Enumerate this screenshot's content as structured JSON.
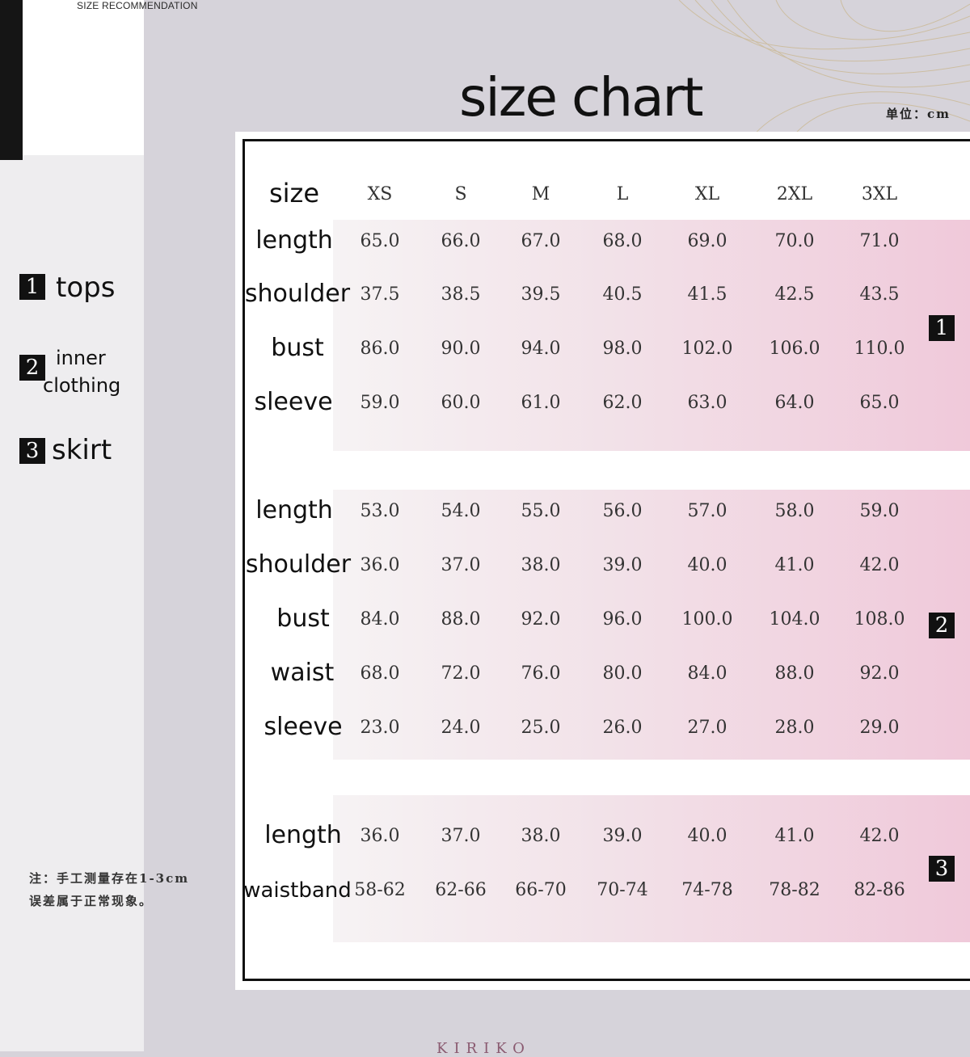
{
  "header_caption": "SIZE RECOMMENDATION",
  "title": "size chart",
  "unit": "单位：cm",
  "legend": [
    {
      "num": "1",
      "label": "tops"
    },
    {
      "num": "2",
      "label_line1": "inner",
      "label_line2": "clothing"
    },
    {
      "num": "3",
      "label": "skirt"
    }
  ],
  "sizes_label": "size",
  "sizes": [
    "XS",
    "S",
    "M",
    "L",
    "XL",
    "2XL",
    "3XL"
  ],
  "groups": [
    {
      "num": "1",
      "rows": [
        {
          "label": "length",
          "values": [
            "65.0",
            "66.0",
            "67.0",
            "68.0",
            "69.0",
            "70.0",
            "71.0"
          ]
        },
        {
          "label": "shoulder",
          "values": [
            "37.5",
            "38.5",
            "39.5",
            "40.5",
            "41.5",
            "42.5",
            "43.5"
          ]
        },
        {
          "label": "bust",
          "values": [
            "86.0",
            "90.0",
            "94.0",
            "98.0",
            "102.0",
            "106.0",
            "110.0"
          ]
        },
        {
          "label": "sleeve",
          "values": [
            "59.0",
            "60.0",
            "61.0",
            "62.0",
            "63.0",
            "64.0",
            "65.0"
          ]
        }
      ]
    },
    {
      "num": "2",
      "rows": [
        {
          "label": "length",
          "values": [
            "53.0",
            "54.0",
            "55.0",
            "56.0",
            "57.0",
            "58.0",
            "59.0"
          ]
        },
        {
          "label": "shoulder",
          "values": [
            "36.0",
            "37.0",
            "38.0",
            "39.0",
            "40.0",
            "41.0",
            "42.0"
          ]
        },
        {
          "label": "bust",
          "values": [
            "84.0",
            "88.0",
            "92.0",
            "96.0",
            "100.0",
            "104.0",
            "108.0"
          ]
        },
        {
          "label": "waist",
          "values": [
            "68.0",
            "72.0",
            "76.0",
            "80.0",
            "84.0",
            "88.0",
            "92.0"
          ]
        },
        {
          "label": "sleeve",
          "values": [
            "23.0",
            "24.0",
            "25.0",
            "26.0",
            "27.0",
            "28.0",
            "29.0"
          ]
        }
      ]
    },
    {
      "num": "3",
      "rows": [
        {
          "label": "length",
          "values": [
            "36.0",
            "37.0",
            "38.0",
            "39.0",
            "40.0",
            "41.0",
            "42.0"
          ]
        },
        {
          "label": "waistband",
          "values": [
            "58-62",
            "62-66",
            "66-70",
            "70-74",
            "74-78",
            "78-82",
            "82-86"
          ]
        }
      ]
    }
  ],
  "note_line1": "注：手工测量存在1-3cm",
  "note_line2": "误差属于正常现象。",
  "brand": "KIRIKO",
  "colors": {
    "band_start": "#f6f3f4",
    "band_end": "#f0c9da",
    "badge": "#111111"
  }
}
